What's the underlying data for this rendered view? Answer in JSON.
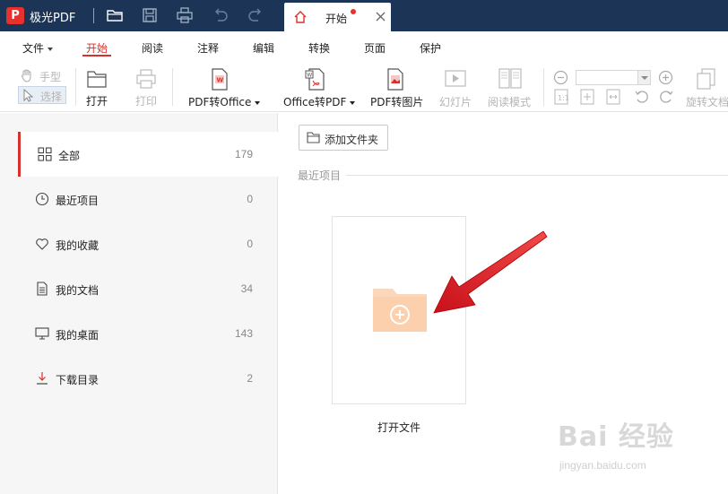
{
  "app": {
    "logo_letter": "P",
    "title": "极光PDF",
    "accent_color": "#d7312c",
    "titlebar_color": "#1c3557"
  },
  "titlebar": {
    "icons": [
      "open-folder-icon",
      "save-icon",
      "print-icon",
      "undo-icon",
      "redo-icon"
    ],
    "tab": {
      "label": "开始",
      "icon": "home-icon",
      "has_notification_dot": true
    }
  },
  "menu": {
    "items": [
      {
        "label": "文件",
        "has_caret": true
      },
      {
        "label": "开始",
        "active": true
      },
      {
        "label": "阅读"
      },
      {
        "label": "注释"
      },
      {
        "label": "编辑"
      },
      {
        "label": "转换"
      },
      {
        "label": "页面"
      },
      {
        "label": "保护"
      }
    ]
  },
  "toolbar": {
    "hand": "手型",
    "select": "选择",
    "open": "打开",
    "print": "打印",
    "pdf_to_office": "PDF转Office",
    "office_to_pdf": "Office转PDF",
    "pdf_to_image": "PDF转图片",
    "slideshow": "幻灯片",
    "reading_mode": "阅读模式",
    "zoom_value": "",
    "rotate_doc": "旋转文档"
  },
  "sidebar": {
    "items": [
      {
        "label": "全部",
        "count": "179",
        "icon": "grid-icon",
        "active": true
      },
      {
        "label": "最近项目",
        "count": "0",
        "icon": "clock-icon"
      },
      {
        "label": "我的收藏",
        "count": "0",
        "icon": "heart-icon"
      },
      {
        "label": "我的文档",
        "count": "34",
        "icon": "document-icon"
      },
      {
        "label": "我的桌面",
        "count": "143",
        "icon": "desktop-icon"
      },
      {
        "label": "下载目录",
        "count": "2",
        "icon": "download-icon"
      }
    ]
  },
  "main": {
    "add_folder": "添加文件夹",
    "section_label": "最近项目",
    "open_file_label": "打开文件"
  },
  "watermark": {
    "main": "Bai 经验",
    "sub": "jingyan.baidu.com"
  }
}
